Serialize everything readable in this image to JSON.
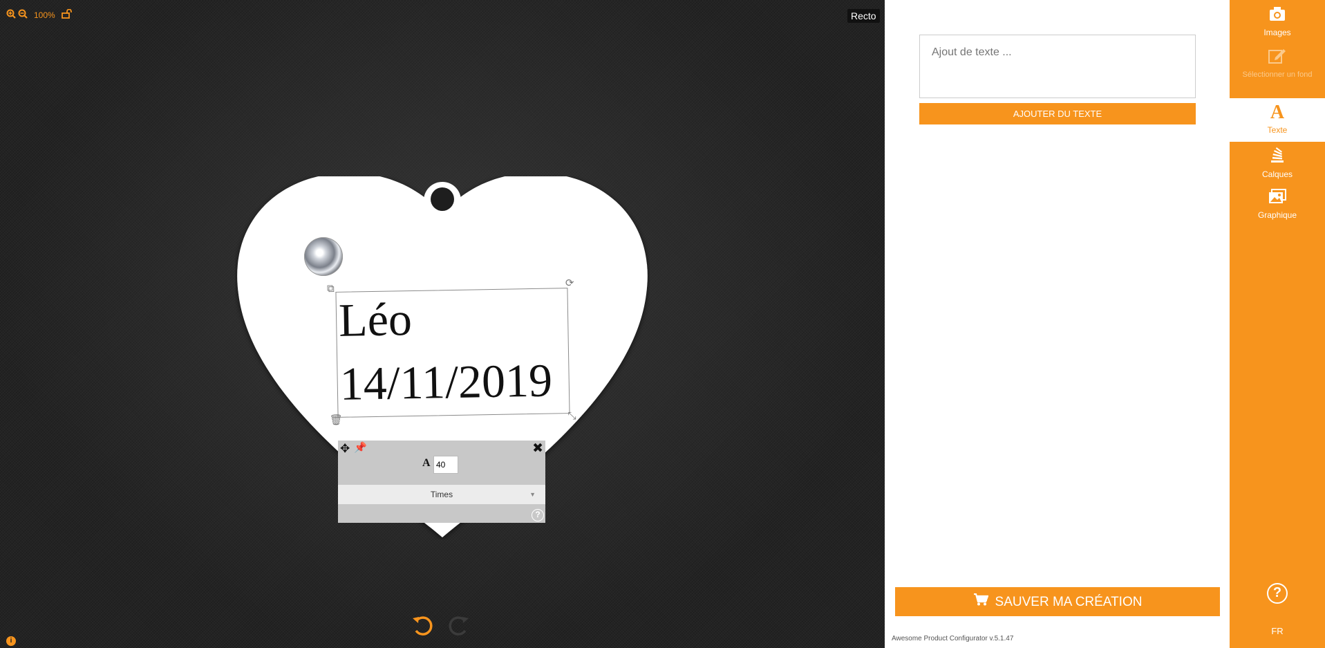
{
  "canvas": {
    "zoom_value": "100%",
    "recto_label": "Recto",
    "design_text": {
      "line1": "Léo",
      "line2": "14/11/2019"
    },
    "tool_panel": {
      "font_size": "40",
      "font_name": "Times"
    }
  },
  "side_panel": {
    "text_placeholder": "Ajout de texte ...",
    "add_text_label": "AJOUTER DU TEXTE",
    "save_label": "SAUVER MA CRÉATION",
    "version": "Awesome Product Configurator v.5.1.47"
  },
  "nav": {
    "items": [
      {
        "label": "Images",
        "icon": "camera-icon"
      },
      {
        "label": "Sélectionner un fond",
        "icon": "edit-icon"
      },
      {
        "label": "Texte",
        "icon": "text-icon"
      },
      {
        "label": "Calques",
        "icon": "layers-icon"
      },
      {
        "label": "Graphique",
        "icon": "image-gallery-icon"
      }
    ],
    "language": "FR"
  },
  "colors": {
    "accent": "#f7941d",
    "canvas_bg": "#232323"
  }
}
